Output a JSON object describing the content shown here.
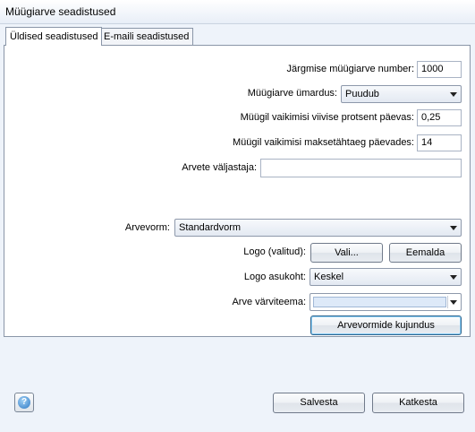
{
  "window": {
    "title": "Müügiarve seadistused"
  },
  "tabs": [
    {
      "label": "Üldised seadistused",
      "active": true
    },
    {
      "label": "E-maili seadistused",
      "active": false
    }
  ],
  "form": {
    "next_number_label": "Järgmise müügiarve number:",
    "next_number_value": "1000",
    "rounding_label": "Müügiarve ümardus:",
    "rounding_value": "Puudub",
    "interest_label": "Müügil vaikimisi viivise protsent päevas:",
    "interest_value": "0,25",
    "due_days_label": "Müügil vaikimisi maksetähtaeg päevades:",
    "due_days_value": "14",
    "issuer_label": "Arvete väljastaja:",
    "issuer_value": "",
    "template_label": "Arvevorm:",
    "template_value": "Standardvorm",
    "logo_label": "Logo (valitud):",
    "logo_choose_button": "Vali...",
    "logo_remove_button": "Eemalda",
    "logo_position_label": "Logo asukoht:",
    "logo_position_value": "Keskel",
    "color_theme_label": "Arve värviteema:",
    "color_theme_swatch": "#dde9f8",
    "design_button": "Arvevormide kujundus"
  },
  "footer": {
    "help_icon": "help-icon",
    "save_button": "Salvesta",
    "cancel_button": "Katkesta"
  }
}
